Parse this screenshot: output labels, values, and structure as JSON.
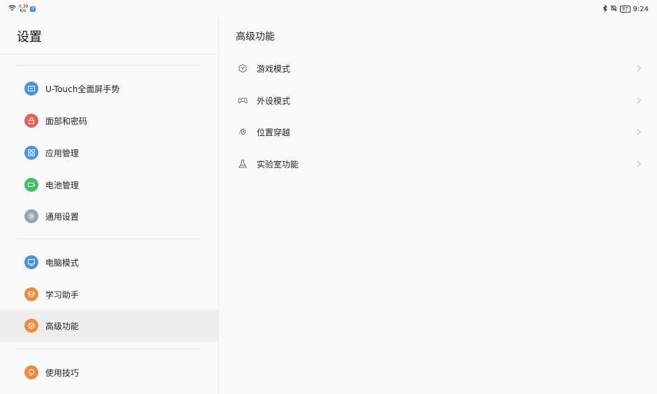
{
  "status_bar": {
    "net_speed_value": "0.39",
    "net_speed_unit": "K/s",
    "notification_badge": "d",
    "battery": "97",
    "time": "9:24"
  },
  "sidebar": {
    "title": "设置",
    "items": [
      {
        "label": "U-Touch全面屏手势",
        "icon": "u-touch-icon",
        "color": "#4a8fe8"
      },
      {
        "label": "面部和密码",
        "icon": "lock-icon",
        "color": "#e8605a"
      },
      {
        "label": "应用管理",
        "icon": "apps-grid-icon",
        "color": "#4a8fe8"
      },
      {
        "label": "电池管理",
        "icon": "battery-icon",
        "color": "#3fbf6a"
      },
      {
        "label": "通用设置",
        "icon": "gear-icon",
        "color": "#9aa3ad"
      },
      {
        "label": "电脑模式",
        "icon": "monitor-icon",
        "color": "#4a8fe8"
      },
      {
        "label": "学习助手",
        "icon": "graduation-cap-icon",
        "color": "#f08a3c"
      },
      {
        "label": "高级功能",
        "icon": "advanced-icon",
        "color": "#f08a3c",
        "active": true
      },
      {
        "label": "使用技巧",
        "icon": "lightbulb-icon",
        "color": "#f08a3c"
      }
    ]
  },
  "content": {
    "title": "高级功能",
    "rows": [
      {
        "label": "游戏模式",
        "icon": "game-mode-icon"
      },
      {
        "label": "外设模式",
        "icon": "gamepad-icon"
      },
      {
        "label": "位置穿越",
        "icon": "location-travel-icon"
      },
      {
        "label": "实验室功能",
        "icon": "flask-icon"
      }
    ]
  }
}
